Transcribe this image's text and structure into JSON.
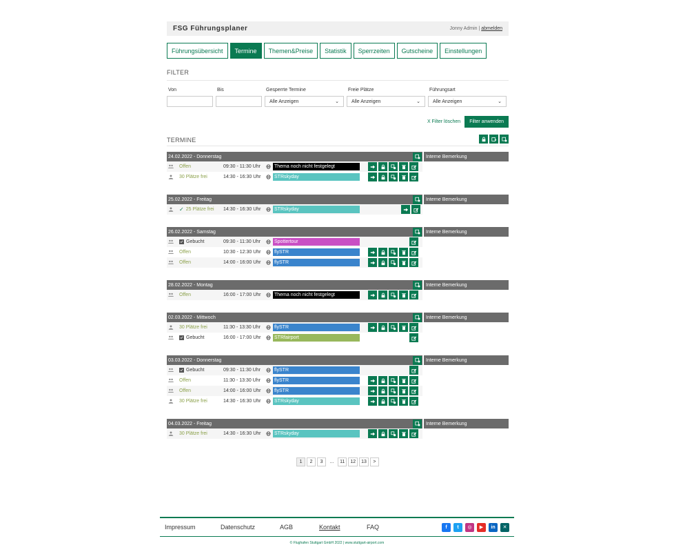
{
  "app": {
    "title": "FSG Führungsplaner",
    "user": "Jonny Admin",
    "logout": "abmelden"
  },
  "tabs": [
    {
      "label": "Führungsübersicht"
    },
    {
      "label": "Termine"
    },
    {
      "label": "Themen&Preise"
    },
    {
      "label": "Statistik"
    },
    {
      "label": "Sperrzeiten"
    },
    {
      "label": "Gutscheine"
    },
    {
      "label": "Einstellungen"
    }
  ],
  "filter": {
    "title": "FILTER",
    "von_label": "Von",
    "bis_label": "Bis",
    "gesperrt_label": "Gesperrte Termine",
    "gesperrt_value": "Alle Anzeigen",
    "freie_label": "Freie Plätze",
    "freie_value": "Alle Anzeigen",
    "art_label": "Führungsart",
    "art_value": "Alle Anzeigen",
    "clear": "X Filter löschen",
    "apply": "Filter anwenden"
  },
  "termine": {
    "title": "TERMINE",
    "remark_header": "Interne Bemerkung",
    "days": [
      {
        "date": "24.02.2022 - Donnerstag",
        "rows": [
          {
            "p": "group",
            "status": "Offen",
            "kind": "offen",
            "time": "09:30 - 11:30 Uhr",
            "theme": "Thema noch nicht festgelegt",
            "color": "#000000",
            "actions": "full"
          },
          {
            "p": "single",
            "status": "30 Plätze frei",
            "kind": "frei",
            "time": "14:30 - 16:30 Uhr",
            "theme": "STRskyday",
            "color": "#5ac4c0",
            "actions": "full"
          }
        ]
      },
      {
        "date": "25.02.2022 - Freitag",
        "rows": [
          {
            "p": "single",
            "status": "25 Plätze frei",
            "kind": "frei-check",
            "time": "14:30 - 16:30 Uhr",
            "theme": "STRskyday",
            "color": "#5ac4c0",
            "actions": "short"
          }
        ]
      },
      {
        "date": "26.02.2022 - Samstag",
        "rows": [
          {
            "p": "group",
            "status": "Gebucht",
            "kind": "gebucht",
            "time": "09:30 - 11:30 Uhr",
            "theme": "Spottertour",
            "color": "#c94fc4",
            "actions": "edit"
          },
          {
            "p": "group",
            "status": "Offen",
            "kind": "offen",
            "time": "10:30 - 12:30 Uhr",
            "theme": "flySTR",
            "color": "#3a84cc",
            "actions": "full"
          },
          {
            "p": "group",
            "status": "Offen",
            "kind": "offen",
            "time": "14:00 - 16:00 Uhr",
            "theme": "flySTR",
            "color": "#3a84cc",
            "actions": "full"
          }
        ]
      },
      {
        "date": "28.02.2022 - Montag",
        "rows": [
          {
            "p": "group",
            "status": "Offen",
            "kind": "offen",
            "time": "16:00 - 17:00 Uhr",
            "theme": "Thema noch nicht festgelegt",
            "color": "#000000",
            "actions": "full"
          }
        ]
      },
      {
        "date": "02.03.2022 - Mittwoch",
        "rows": [
          {
            "p": "single",
            "status": "30 Plätze frei",
            "kind": "frei",
            "time": "11:30 - 13:30 Uhr",
            "theme": "flySTR",
            "color": "#3a84cc",
            "actions": "full"
          },
          {
            "p": "group",
            "status": "Gebucht",
            "kind": "gebucht",
            "time": "16:00 - 17:00 Uhr",
            "theme": "STRfairport",
            "color": "#98b85c",
            "actions": "edit"
          }
        ]
      },
      {
        "date": "03.03.2022 - Donnerstag",
        "rows": [
          {
            "p": "group",
            "status": "Gebucht",
            "kind": "gebucht",
            "time": "09:30 - 11:30 Uhr",
            "theme": "flySTR",
            "color": "#3a84cc",
            "actions": "edit"
          },
          {
            "p": "group",
            "status": "Offen",
            "kind": "offen",
            "time": "11:30 - 13:30 Uhr",
            "theme": "flySTR",
            "color": "#3a84cc",
            "actions": "full"
          },
          {
            "p": "group",
            "status": "Offen",
            "kind": "offen",
            "time": "14:00 - 16:00 Uhr",
            "theme": "flySTR",
            "color": "#3a84cc",
            "actions": "full"
          },
          {
            "p": "single",
            "status": "30 Plätze frei",
            "kind": "frei",
            "time": "14:30 - 16:30 Uhr",
            "theme": "STRskyday",
            "color": "#5ac4c0",
            "actions": "full"
          }
        ]
      },
      {
        "date": "04.03.2022 - Freitag",
        "rows": [
          {
            "p": "single",
            "status": "30 Plätze frei",
            "kind": "frei",
            "time": "14:30 - 16:30 Uhr",
            "theme": "STRskyday",
            "color": "#5ac4c0",
            "actions": "full"
          }
        ]
      }
    ]
  },
  "pager": [
    "1",
    "2",
    "3",
    "...",
    "11",
    "12",
    "13",
    ">"
  ],
  "footer": {
    "links": [
      {
        "label": "Impressum"
      },
      {
        "label": "Datenschutz"
      },
      {
        "label": "AGB"
      },
      {
        "label": "Kontakt"
      },
      {
        "label": "FAQ"
      }
    ],
    "social": [
      {
        "name": "facebook-icon",
        "glyph": "f",
        "color": "#1877f2"
      },
      {
        "name": "twitter-icon",
        "glyph": "t",
        "color": "#1da1f2"
      },
      {
        "name": "instagram-icon",
        "glyph": "◎",
        "color": "#c13584"
      },
      {
        "name": "youtube-icon",
        "glyph": "▶",
        "color": "#e52d27"
      },
      {
        "name": "linkedin-icon",
        "glyph": "in",
        "color": "#0a66c2"
      },
      {
        "name": "xing-icon",
        "glyph": "✕",
        "color": "#026466"
      }
    ],
    "copyright": "© Flughafen Stuttgart GmbH 2022 | www.stuttgart-airport.com"
  }
}
